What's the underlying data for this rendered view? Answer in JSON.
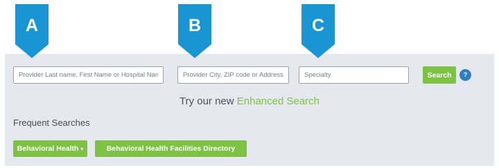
{
  "markers": [
    {
      "letter": "A",
      "color": "#1a95d4"
    },
    {
      "letter": "B",
      "color": "#1a95d4"
    },
    {
      "letter": "C",
      "color": "#1a95d4"
    }
  ],
  "search": {
    "provider_name_placeholder": "Provider Last name, First Name or Hospital Name",
    "location_placeholder": "Provider City, ZIP code or Address",
    "specialty_placeholder": "Specialty",
    "search_label": "Search",
    "help_label": "?"
  },
  "enhanced": {
    "prefix": "Try our new ",
    "link_label": "Enhanced Search"
  },
  "frequent": {
    "heading": "Frequent Searches",
    "buttons": [
      {
        "label": "Behavioral Health",
        "caret": "▾"
      },
      {
        "label": "Behavioral Health Facilities Directory"
      }
    ]
  },
  "colors": {
    "panel_bg": "#e5e8ef",
    "accent_green": "#7dc242",
    "marker_blue": "#1a95d4",
    "help_blue": "#2d7fc1"
  }
}
